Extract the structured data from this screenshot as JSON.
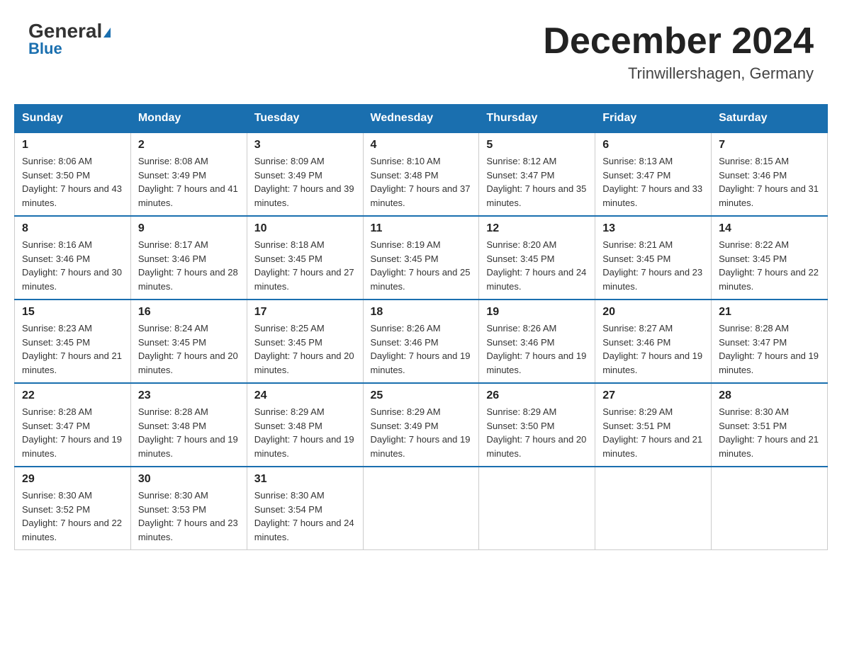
{
  "header": {
    "logo_general": "General",
    "logo_blue": "Blue",
    "month_title": "December 2024",
    "location": "Trinwillershagen, Germany"
  },
  "days_of_week": [
    "Sunday",
    "Monday",
    "Tuesday",
    "Wednesday",
    "Thursday",
    "Friday",
    "Saturday"
  ],
  "weeks": [
    [
      {
        "num": "1",
        "sunrise": "8:06 AM",
        "sunset": "3:50 PM",
        "daylight": "7 hours and 43 minutes."
      },
      {
        "num": "2",
        "sunrise": "8:08 AM",
        "sunset": "3:49 PM",
        "daylight": "7 hours and 41 minutes."
      },
      {
        "num": "3",
        "sunrise": "8:09 AM",
        "sunset": "3:49 PM",
        "daylight": "7 hours and 39 minutes."
      },
      {
        "num": "4",
        "sunrise": "8:10 AM",
        "sunset": "3:48 PM",
        "daylight": "7 hours and 37 minutes."
      },
      {
        "num": "5",
        "sunrise": "8:12 AM",
        "sunset": "3:47 PM",
        "daylight": "7 hours and 35 minutes."
      },
      {
        "num": "6",
        "sunrise": "8:13 AM",
        "sunset": "3:47 PM",
        "daylight": "7 hours and 33 minutes."
      },
      {
        "num": "7",
        "sunrise": "8:15 AM",
        "sunset": "3:46 PM",
        "daylight": "7 hours and 31 minutes."
      }
    ],
    [
      {
        "num": "8",
        "sunrise": "8:16 AM",
        "sunset": "3:46 PM",
        "daylight": "7 hours and 30 minutes."
      },
      {
        "num": "9",
        "sunrise": "8:17 AM",
        "sunset": "3:46 PM",
        "daylight": "7 hours and 28 minutes."
      },
      {
        "num": "10",
        "sunrise": "8:18 AM",
        "sunset": "3:45 PM",
        "daylight": "7 hours and 27 minutes."
      },
      {
        "num": "11",
        "sunrise": "8:19 AM",
        "sunset": "3:45 PM",
        "daylight": "7 hours and 25 minutes."
      },
      {
        "num": "12",
        "sunrise": "8:20 AM",
        "sunset": "3:45 PM",
        "daylight": "7 hours and 24 minutes."
      },
      {
        "num": "13",
        "sunrise": "8:21 AM",
        "sunset": "3:45 PM",
        "daylight": "7 hours and 23 minutes."
      },
      {
        "num": "14",
        "sunrise": "8:22 AM",
        "sunset": "3:45 PM",
        "daylight": "7 hours and 22 minutes."
      }
    ],
    [
      {
        "num": "15",
        "sunrise": "8:23 AM",
        "sunset": "3:45 PM",
        "daylight": "7 hours and 21 minutes."
      },
      {
        "num": "16",
        "sunrise": "8:24 AM",
        "sunset": "3:45 PM",
        "daylight": "7 hours and 20 minutes."
      },
      {
        "num": "17",
        "sunrise": "8:25 AM",
        "sunset": "3:45 PM",
        "daylight": "7 hours and 20 minutes."
      },
      {
        "num": "18",
        "sunrise": "8:26 AM",
        "sunset": "3:46 PM",
        "daylight": "7 hours and 19 minutes."
      },
      {
        "num": "19",
        "sunrise": "8:26 AM",
        "sunset": "3:46 PM",
        "daylight": "7 hours and 19 minutes."
      },
      {
        "num": "20",
        "sunrise": "8:27 AM",
        "sunset": "3:46 PM",
        "daylight": "7 hours and 19 minutes."
      },
      {
        "num": "21",
        "sunrise": "8:28 AM",
        "sunset": "3:47 PM",
        "daylight": "7 hours and 19 minutes."
      }
    ],
    [
      {
        "num": "22",
        "sunrise": "8:28 AM",
        "sunset": "3:47 PM",
        "daylight": "7 hours and 19 minutes."
      },
      {
        "num": "23",
        "sunrise": "8:28 AM",
        "sunset": "3:48 PM",
        "daylight": "7 hours and 19 minutes."
      },
      {
        "num": "24",
        "sunrise": "8:29 AM",
        "sunset": "3:48 PM",
        "daylight": "7 hours and 19 minutes."
      },
      {
        "num": "25",
        "sunrise": "8:29 AM",
        "sunset": "3:49 PM",
        "daylight": "7 hours and 19 minutes."
      },
      {
        "num": "26",
        "sunrise": "8:29 AM",
        "sunset": "3:50 PM",
        "daylight": "7 hours and 20 minutes."
      },
      {
        "num": "27",
        "sunrise": "8:29 AM",
        "sunset": "3:51 PM",
        "daylight": "7 hours and 21 minutes."
      },
      {
        "num": "28",
        "sunrise": "8:30 AM",
        "sunset": "3:51 PM",
        "daylight": "7 hours and 21 minutes."
      }
    ],
    [
      {
        "num": "29",
        "sunrise": "8:30 AM",
        "sunset": "3:52 PM",
        "daylight": "7 hours and 22 minutes."
      },
      {
        "num": "30",
        "sunrise": "8:30 AM",
        "sunset": "3:53 PM",
        "daylight": "7 hours and 23 minutes."
      },
      {
        "num": "31",
        "sunrise": "8:30 AM",
        "sunset": "3:54 PM",
        "daylight": "7 hours and 24 minutes."
      },
      null,
      null,
      null,
      null
    ]
  ]
}
